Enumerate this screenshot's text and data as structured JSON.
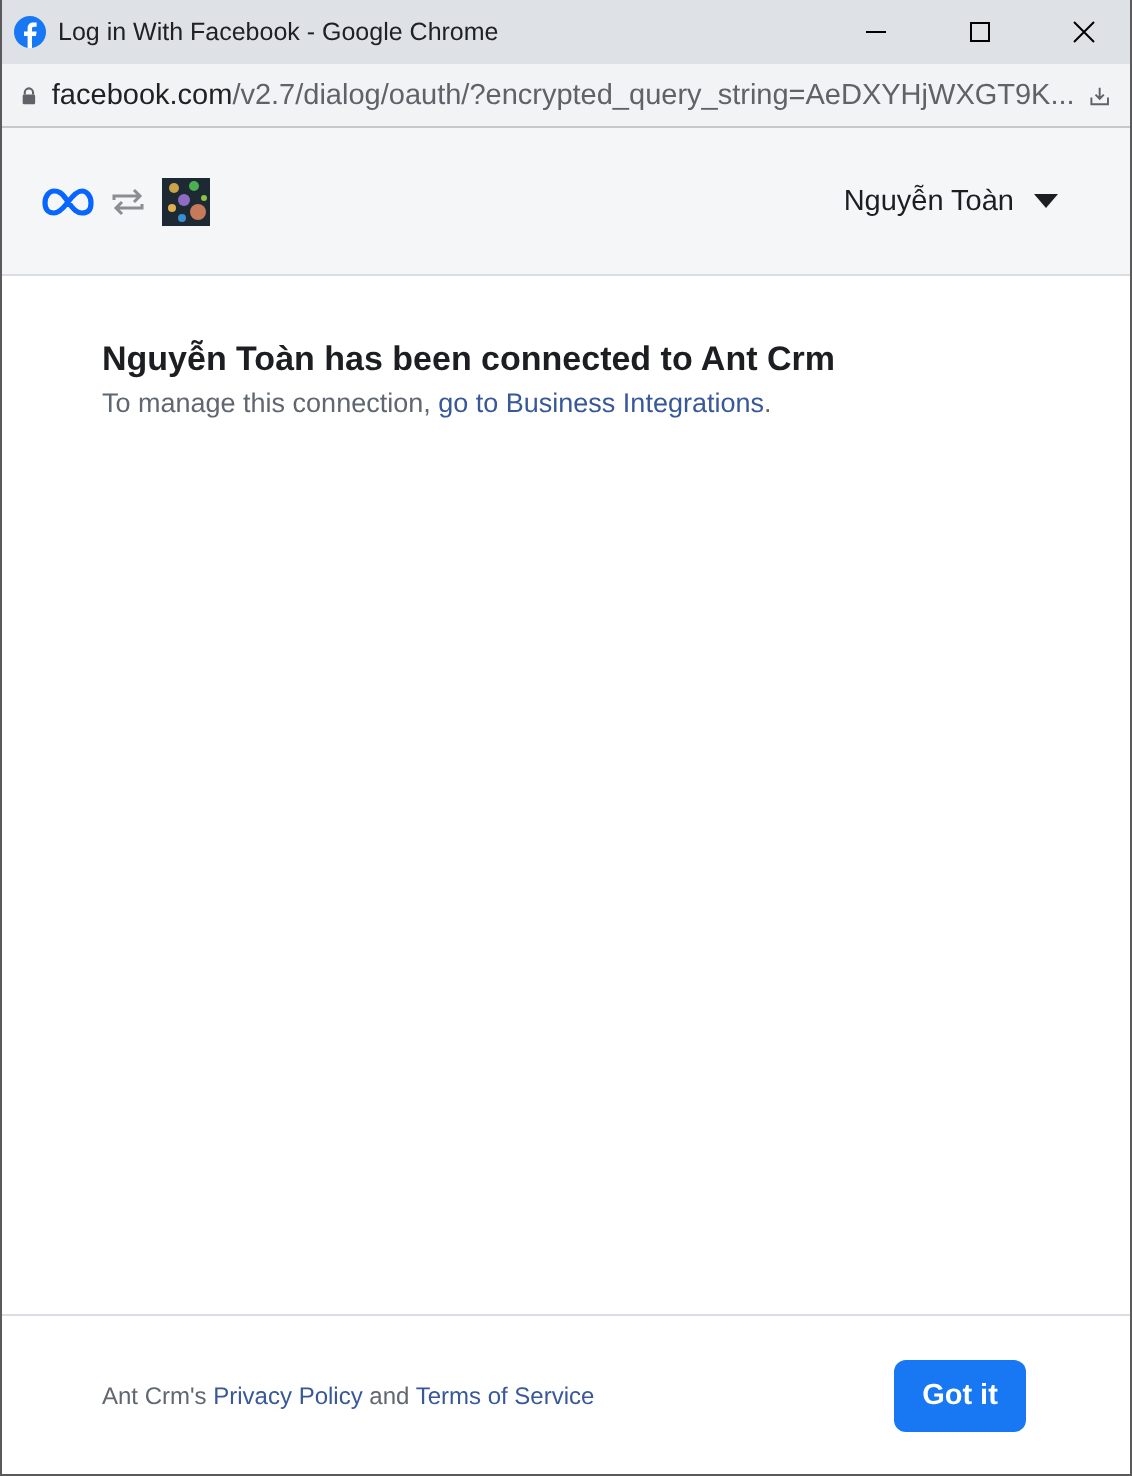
{
  "window": {
    "title": "Log in With Facebook - Google Chrome"
  },
  "address_bar": {
    "host": "facebook.com",
    "path": "/v2.7/dialog/oauth/?encrypted_query_string=AeDXYHjWXGT9K..."
  },
  "header": {
    "user_name": "Nguyễn Toàn"
  },
  "message": {
    "title": "Nguyễn Toàn has been connected to Ant Crm",
    "text_before": "To manage this connection,",
    "link": "go to Business Integrations",
    "text_after": "."
  },
  "footer": {
    "app_name": "Ant Crm's",
    "privacy_link": "Privacy Policy",
    "joiner": "and",
    "terms_link": "Terms of Service",
    "button": "Got it"
  }
}
